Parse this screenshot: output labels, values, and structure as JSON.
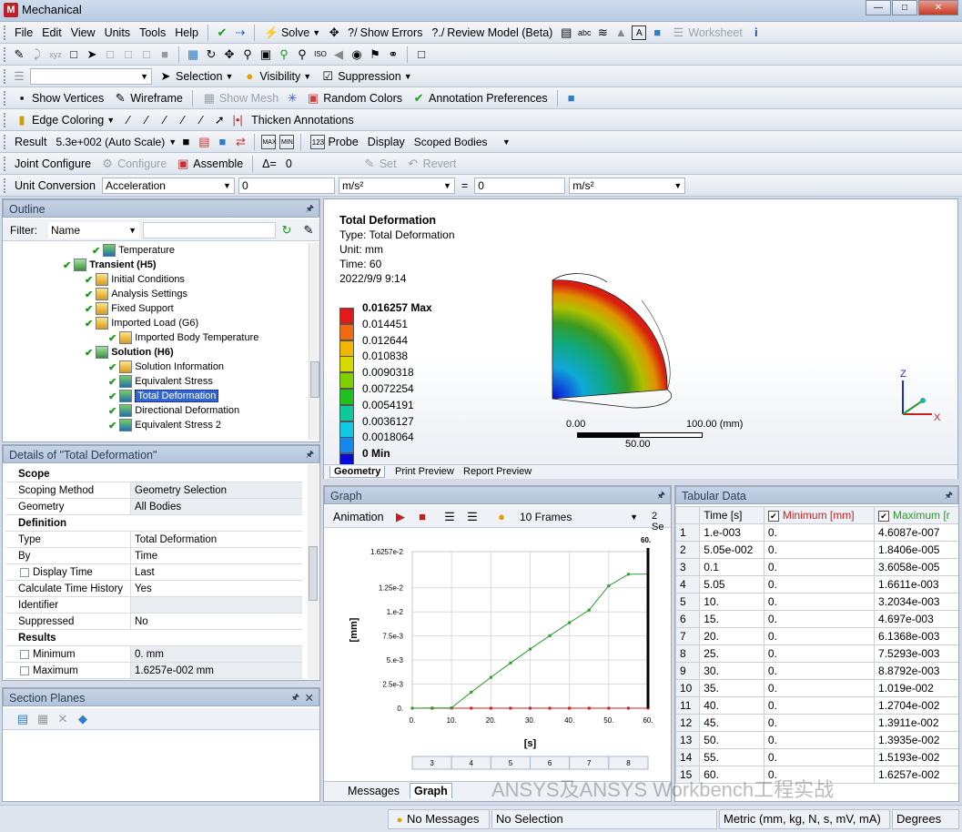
{
  "app": {
    "title": "Mechanical",
    "logo_letter": "M"
  },
  "menu": [
    "File",
    "Edit",
    "View",
    "Units",
    "Tools",
    "Help"
  ],
  "toolbar1": {
    "solve": "Solve",
    "show_errors": "Show Errors",
    "review_model": "Review Model (Beta)",
    "worksheet": "Worksheet"
  },
  "toolbar3": {
    "selection": "Selection",
    "visibility": "Visibility",
    "suppression": "Suppression"
  },
  "toolbar4": {
    "show_vertices": "Show Vertices",
    "wireframe": "Wireframe",
    "show_mesh": "Show Mesh",
    "random_colors": "Random Colors",
    "annotation_prefs": "Annotation Preferences"
  },
  "toolbar5": {
    "edge_coloring": "Edge Coloring",
    "thicken": "Thicken Annotations"
  },
  "result_bar": {
    "result_label": "Result",
    "scale": "5.3e+002 (Auto Scale)",
    "probe": "Probe",
    "display_label": "Display",
    "display_value": "Scoped Bodies"
  },
  "joint_bar": {
    "joint_configure": "Joint Configure",
    "configure": "Configure",
    "assemble": "Assemble",
    "delta": "Δ=",
    "delta_val": "0",
    "set": "Set",
    "revert": "Revert"
  },
  "unit_bar": {
    "label": "Unit Conversion",
    "quantity": "Acceleration",
    "val1": "0",
    "unit1": "m/s²",
    "eq": "=",
    "val2": "0",
    "unit2": "m/s²"
  },
  "outline": {
    "title": "Outline",
    "filter_label": "Filter:",
    "filter_value": "Name",
    "items": [
      {
        "label": "Temperature",
        "bold": false
      },
      {
        "label": "Transient (H5)",
        "bold": true
      },
      {
        "label": "Initial Conditions",
        "bold": false
      },
      {
        "label": "Analysis Settings",
        "bold": false
      },
      {
        "label": "Fixed Support",
        "bold": false
      },
      {
        "label": "Imported Load (G6)",
        "bold": false
      },
      {
        "label": "Imported Body Temperature",
        "bold": false
      },
      {
        "label": "Solution (H6)",
        "bold": true
      },
      {
        "label": "Solution Information",
        "bold": false
      },
      {
        "label": "Equivalent Stress",
        "bold": false
      },
      {
        "label": "Total Deformation",
        "bold": false
      },
      {
        "label": "Directional Deformation",
        "bold": false
      },
      {
        "label": "Equivalent Stress 2",
        "bold": false
      }
    ]
  },
  "details": {
    "title": "Details of \"Total Deformation\"",
    "sections": {
      "scope": "Scope",
      "definition": "Definition",
      "results": "Results"
    },
    "rows": {
      "scoping_method": [
        "Scoping Method",
        "Geometry Selection"
      ],
      "geometry": [
        "Geometry",
        "All Bodies"
      ],
      "type": [
        "Type",
        "Total Deformation"
      ],
      "by": [
        "By",
        "Time"
      ],
      "display_time": [
        "Display Time",
        "Last"
      ],
      "calc_history": [
        "Calculate Time History",
        "Yes"
      ],
      "identifier": [
        "Identifier",
        ""
      ],
      "suppressed": [
        "Suppressed",
        "No"
      ],
      "minimum": [
        "Minimum",
        "0. mm"
      ],
      "maximum": [
        "Maximum",
        "1.6257e-002 mm"
      ]
    }
  },
  "section_planes": {
    "title": "Section Planes"
  },
  "viewport": {
    "title": "Total Deformation",
    "type_line": "Type: Total Deformation",
    "unit_line": "Unit: mm",
    "time_line": "Time: 60",
    "date_line": "2022/9/9 9:14",
    "legend": [
      {
        "label": "0.016257 Max",
        "color": "#e41a1a"
      },
      {
        "label": "0.014451",
        "color": "#ef6a10"
      },
      {
        "label": "0.012644",
        "color": "#f2b500"
      },
      {
        "label": "0.010838",
        "color": "#d6d800"
      },
      {
        "label": "0.0090318",
        "color": "#7fd000"
      },
      {
        "label": "0.0072254",
        "color": "#1fc020"
      },
      {
        "label": "0.0054191",
        "color": "#10c89a"
      },
      {
        "label": "0.0036127",
        "color": "#10c8e0"
      },
      {
        "label": "0.0018064",
        "color": "#1488ee"
      },
      {
        "label": "0 Min",
        "color": "#0a0ad8"
      }
    ],
    "scale_left": "0.00",
    "scale_right": "100.00 (mm)",
    "scale_mid": "50.00",
    "tabs": [
      "Geometry",
      "Print Preview",
      "Report Preview"
    ]
  },
  "graph": {
    "title": "Graph",
    "animation_label": "Animation",
    "frames": "10 Frames",
    "sec": "2 Se",
    "tabs": [
      "Messages",
      "Graph"
    ]
  },
  "chart_data": {
    "type": "line",
    "title": "",
    "xlabel": "[s]",
    "ylabel": "[mm]",
    "xlim": [
      0,
      60
    ],
    "ylim": [
      0,
      0.016257
    ],
    "xticks": [
      "0.",
      "10.",
      "20.",
      "30.",
      "40.",
      "50.",
      "60."
    ],
    "yticks": [
      "0.",
      "2.5e-3",
      "5.e-3",
      "7.5e-3",
      "1.e-2",
      "1.25e-2",
      "1.6257e-2"
    ],
    "top_label": "60.",
    "bottom_frames": [
      "3",
      "4",
      "5",
      "6",
      "7",
      "8"
    ],
    "x": [
      0.001,
      5.05,
      10,
      15,
      20,
      25,
      30,
      35,
      40,
      45,
      50,
      55,
      60
    ],
    "series": [
      {
        "name": "Minimum [mm]",
        "color": "#cc2020",
        "values": [
          0,
          0,
          0,
          0,
          0,
          0,
          0,
          0,
          0,
          0,
          0,
          0,
          0
        ]
      },
      {
        "name": "Maximum [mm]",
        "color": "#2a9a2a",
        "values": [
          4.6087e-07,
          1.8406e-05,
          3.6058e-05,
          0.0016611,
          0.0032034,
          0.004697,
          0.0061368,
          0.0075293,
          0.0088792,
          0.01019,
          0.012704,
          0.013911,
          0.013935
        ]
      }
    ]
  },
  "tabular": {
    "title": "Tabular Data",
    "headers": [
      "Time [s]",
      "Minimum [mm]",
      "Maximum [r"
    ],
    "rows": [
      [
        "1",
        "1.e-003",
        "0.",
        "4.6087e-007"
      ],
      [
        "2",
        "5.05e-002",
        "0.",
        "1.8406e-005"
      ],
      [
        "3",
        "0.1",
        "0.",
        "3.6058e-005"
      ],
      [
        "4",
        "5.05",
        "0.",
        "1.6611e-003"
      ],
      [
        "5",
        "10.",
        "0.",
        "3.2034e-003"
      ],
      [
        "6",
        "15.",
        "0.",
        "4.697e-003"
      ],
      [
        "7",
        "20.",
        "0.",
        "6.1368e-003"
      ],
      [
        "8",
        "25.",
        "0.",
        "7.5293e-003"
      ],
      [
        "9",
        "30.",
        "0.",
        "8.8792e-003"
      ],
      [
        "10",
        "35.",
        "0.",
        "1.019e-002"
      ],
      [
        "11",
        "40.",
        "0.",
        "1.2704e-002"
      ],
      [
        "12",
        "45.",
        "0.",
        "1.3911e-002"
      ],
      [
        "13",
        "50.",
        "0.",
        "1.3935e-002"
      ],
      [
        "14",
        "55.",
        "0.",
        "1.5193e-002"
      ],
      [
        "15",
        "60.",
        "0.",
        "1.6257e-002"
      ]
    ]
  },
  "watermark": "ANSYS及ANSYS Workbench工程实战",
  "status": {
    "messages": "No Messages",
    "selection": "No Selection",
    "units": "Metric (mm, kg, N, s, mV, mA)",
    "degrees": "Degrees"
  }
}
